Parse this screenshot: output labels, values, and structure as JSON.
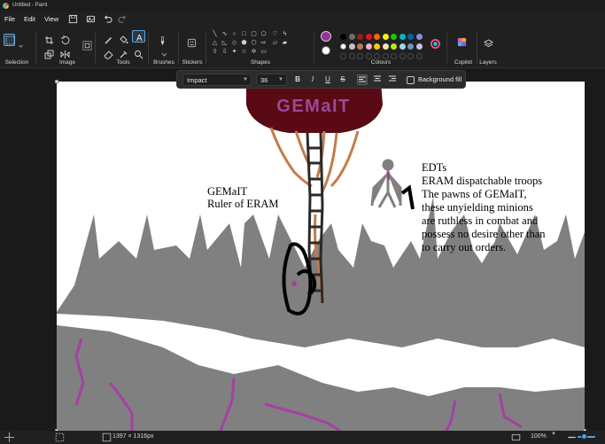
{
  "window": {
    "title": "Untitled - Paint"
  },
  "menu": {
    "file": "File",
    "edit": "Edit",
    "view": "View"
  },
  "ribbon": {
    "groups": {
      "selection": "Selection",
      "image": "Image",
      "tools": "Tools",
      "brushes": "Brushes",
      "stickers": "Stickers",
      "shapes": "Shapes",
      "colours": "Colours",
      "copilot": "Copilot",
      "layers": "Layers"
    },
    "palette_row1": [
      "#000000",
      "#6d6d6d",
      "#9b1b1b",
      "#e81123",
      "#f7630c",
      "#fff100",
      "#16c60c",
      "#00b7c3",
      "#0063b1",
      "#8e8cd8"
    ],
    "palette_row2": [
      "#ffffff",
      "#c4c4c4",
      "#b97a57",
      "#ffaec9",
      "#ffc90e",
      "#efe4b0",
      "#b5e61d",
      "#99d9ea",
      "#7092be",
      "#c8bfe7"
    ],
    "primary_colour": "#9b2f9b",
    "secondary_colour": "#ffffff"
  },
  "textbar": {
    "font": "Impact",
    "size": "36",
    "bold": "B",
    "italic": "I",
    "underline": "U",
    "strike": "S",
    "background_fill": "Background fill"
  },
  "canvas": {
    "banner": "GEMaIT",
    "ruler_caption": [
      "GEMaIT",
      "Ruler of ERAM"
    ],
    "edt_caption": [
      "EDTs",
      "ERAM dispatchable troops",
      "The pawns of GEMaIT,",
      "these unyielding minions",
      "are ruthless in combat and",
      "possess no desire other than",
      "to carry out orders."
    ]
  },
  "status": {
    "dimensions": "1397 × 1316px",
    "zoom": "100%"
  }
}
